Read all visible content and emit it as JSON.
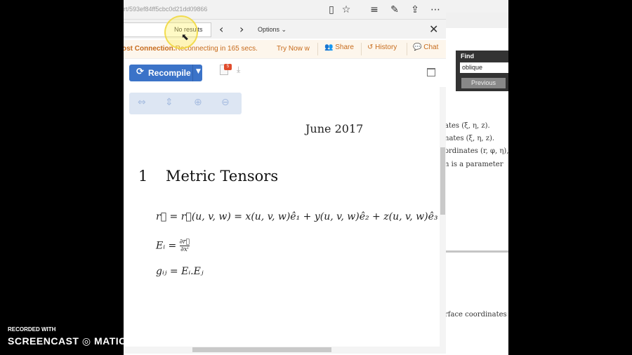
{
  "browser": {
    "url": "rt/593ef84ff5cbc0d21dd09866",
    "icons": [
      "reading-view-icon",
      "favorite-star-icon",
      "hub-icon",
      "web-note-icon",
      "share-icon",
      "more-icon"
    ]
  },
  "findbar": {
    "status": "No results",
    "prev_glyph": "‹",
    "next_glyph": "›",
    "options_label": "Options",
    "close_glyph": "✕"
  },
  "notice": {
    "lost": "ost Connection.",
    "reconnecting": "Reconnecting in 165 secs.",
    "try_now": "Try Now",
    "extra": "w",
    "share": "Share",
    "history": "History",
    "chat": "Chat"
  },
  "toolbar": {
    "recompile": "Recompile",
    "log_badge": "5"
  },
  "document": {
    "date": "June 2017",
    "section_number": "1",
    "section_title": "Metric Tensors",
    "eq1": "r⃗ = r⃗(u, v, w) = x(u, v, w)ê₁ + y(u, v, w)ê₂ + z(u, v, w)ê₃",
    "eq2_lhs": "Eᵢ =",
    "eq2_num": "∂r⃗",
    "eq2_den": "∂xⁱ",
    "eq3": "gᵢⱼ = Eᵢ.Eⱼ"
  },
  "background_window": {
    "lines": [
      "ates (ξ, η, z).",
      "nates (ξ, η, z).",
      "ordinates (r, φ, η),",
      "n is a parameter",
      "rface coordinates"
    ]
  },
  "find_panel": {
    "label": "Find",
    "input_value": "oblique",
    "previous": "Previous"
  },
  "watermark": {
    "line1": "RECORDED WITH",
    "line2": "SCREENCAST",
    "line3": "MATIC"
  },
  "colors": {
    "accent": "#3b73c8",
    "notice": "#c76b1c"
  }
}
